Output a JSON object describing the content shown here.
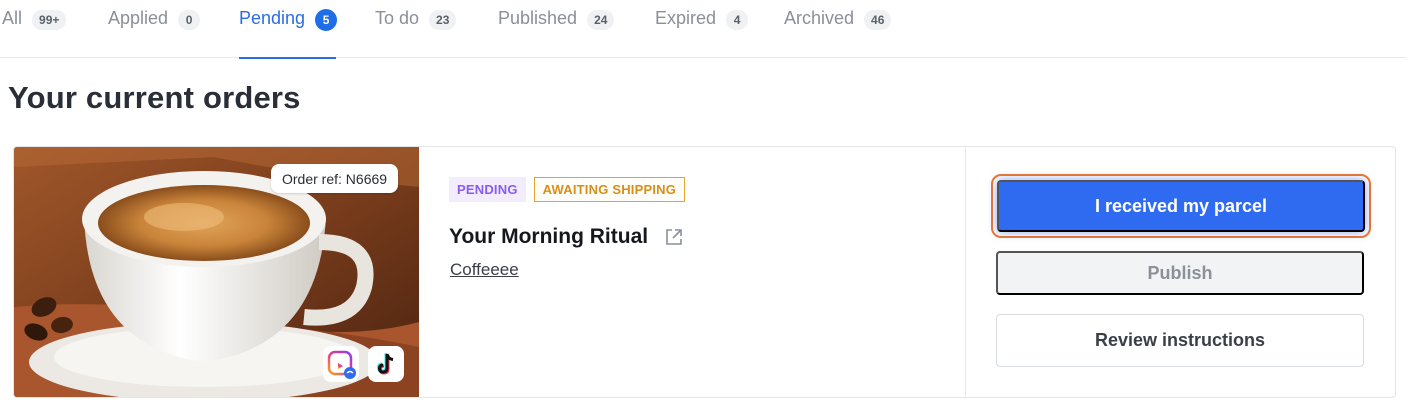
{
  "tabs": [
    {
      "label": "All",
      "count": "99+"
    },
    {
      "label": "Applied",
      "count": "0"
    },
    {
      "label": "Pending",
      "count": "5",
      "active": true
    },
    {
      "label": "To do",
      "count": "23"
    },
    {
      "label": "Published",
      "count": "24"
    },
    {
      "label": "Expired",
      "count": "4"
    },
    {
      "label": "Archived",
      "count": "46"
    }
  ],
  "page_title": "Your current orders",
  "order": {
    "ref": "Order ref: N6669",
    "status_badge": "PENDING",
    "shipping_badge": "AWAITING SHIPPING",
    "product_name": "Your Morning Ritual",
    "brand": "Coffeeee",
    "platforms": [
      "instagram-reels-icon",
      "tiktok-icon"
    ],
    "actions": {
      "received": "I received my parcel",
      "publish": "Publish",
      "review": "Review instructions"
    }
  },
  "colors": {
    "accent": "#2b6ce6",
    "primary_button": "#2f6bf0",
    "highlight_outline": "#f07a2b",
    "pending_badge": "#8a5cf0",
    "awaiting_badge": "#d6901a"
  }
}
